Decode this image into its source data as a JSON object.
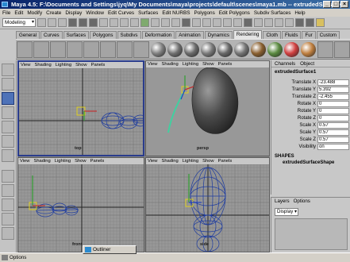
{
  "window": {
    "title": "Maya 4.5: F:\\Documents and Settings\\jyq\\My Documents\\maya\\projects\\default\\scenes\\maya1.mb  --  extrudedSurface1"
  },
  "menubar": {
    "items": [
      "File",
      "Edit",
      "Modify",
      "Create",
      "Display",
      "Window",
      "Edit Curves",
      "Surfaces",
      "Edit NURBS",
      "Polygons",
      "Edit Polygons",
      "Subdiv Surfaces",
      "Help"
    ]
  },
  "statusline": {
    "mode": "Modeling"
  },
  "shelf": {
    "tabs": [
      "General",
      "Curves",
      "Surfaces",
      "Polygons",
      "Subdivs",
      "Deformation",
      "Animation",
      "Dynamics",
      "Rendering",
      "Cloth",
      "Fluids",
      "Fur",
      "Custom"
    ],
    "active_tab": "Rendering",
    "shader_ball_colors": [
      "#808080",
      "#707070",
      "#6a6a6a",
      "#7a7a7a",
      "#686868",
      "#747474",
      "#8a6030",
      "#5a8a40",
      "#d04040",
      "#c08040"
    ]
  },
  "viewports": [
    {
      "id": "top",
      "menus": [
        "View",
        "Shading",
        "Lighting",
        "Show",
        "Panels"
      ],
      "camera": "top",
      "active": true
    },
    {
      "id": "persp",
      "menus": [
        "View",
        "Shading",
        "Lighting",
        "Show",
        "Panels"
      ],
      "camera": "persp",
      "active": false
    },
    {
      "id": "front",
      "menus": [
        "View",
        "Shading",
        "Lighting",
        "Show",
        "Panels"
      ],
      "camera": "front",
      "active": false
    },
    {
      "id": "side",
      "menus": [
        "View",
        "Shading",
        "Lighting",
        "Show",
        "Panels"
      ],
      "camera": "side",
      "active": false
    }
  ],
  "channel_box": {
    "tabs": [
      "Channels",
      "Object"
    ],
    "node": "extrudedSurface1",
    "attributes": [
      {
        "name": "Translate X",
        "value": "-23.488"
      },
      {
        "name": "Translate Y",
        "value": "5.392"
      },
      {
        "name": "Translate Z",
        "value": "-2.455"
      },
      {
        "name": "Rotate X",
        "value": "0"
      },
      {
        "name": "Rotate Y",
        "value": "0"
      },
      {
        "name": "Rotate Z",
        "value": "0"
      },
      {
        "name": "Scale X",
        "value": "0.57"
      },
      {
        "name": "Scale Y",
        "value": "0.57"
      },
      {
        "name": "Scale Z",
        "value": "0.57"
      },
      {
        "name": "Visibility",
        "value": "on"
      }
    ],
    "shapes_header": "SHAPES",
    "shape_name": "extrudedSurfaceShape"
  },
  "layers": {
    "tabs": [
      "Layers",
      "Options"
    ],
    "selected": "Display"
  },
  "taskbar": {
    "items": [
      "Options",
      "Outliner"
    ]
  },
  "colors": {
    "selection_blue": "#2a3c8c",
    "title_blue": "#0a246a",
    "wire_blue": "#1e3ca0",
    "manipulator_yellow": "#e0d020"
  }
}
